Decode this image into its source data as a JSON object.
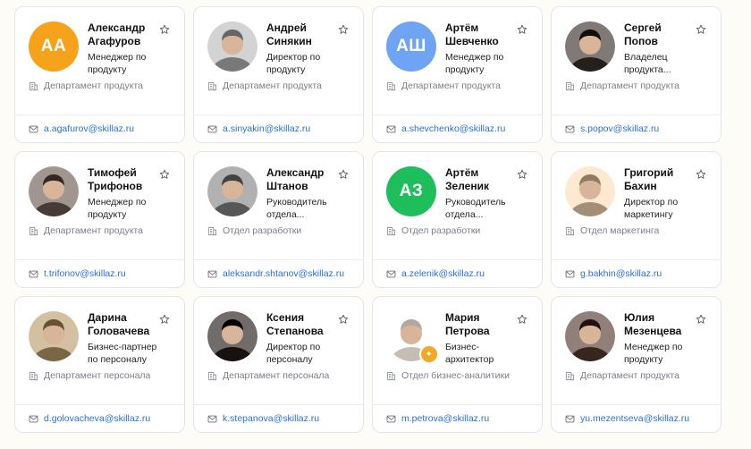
{
  "colors": {
    "accent_link": "#2a6fd6",
    "initials_orange": "#f7a21b",
    "initials_blue": "#6fa3f4",
    "initials_green": "#1fbe5d"
  },
  "employees": [
    {
      "name": "Александр Агафуров",
      "role": "Менеджер по продукту",
      "department": "Департамент продукта",
      "email": "a.agafurov@skillaz.ru",
      "avatar": {
        "type": "initials",
        "text": "АА",
        "color": "#f7a21b"
      }
    },
    {
      "name": "Андрей Синякин",
      "role": "Директор по продукту",
      "department": "Департамент продукта",
      "email": "a.sinyakin@skillaz.ru",
      "avatar": {
        "type": "photo",
        "tone": "#8d8d8d"
      }
    },
    {
      "name": "Артём Шевченко",
      "role": "Менеджер по продукту",
      "department": "Департамент продукта",
      "email": "a.shevchenko@skillaz.ru",
      "avatar": {
        "type": "initials",
        "text": "АШ",
        "color": "#6fa3f4"
      }
    },
    {
      "name": "Сергей Попов",
      "role": "Владелец продукта...",
      "department": "Департамент продукта",
      "email": "s.popov@skillaz.ru",
      "avatar": {
        "type": "photo",
        "tone": "#3a3330"
      }
    },
    {
      "name": "Тимофей Трифонов",
      "role": "Менеджер по продукту",
      "department": "Департамент продукта",
      "email": "t.trifonov@skillaz.ru",
      "avatar": {
        "type": "photo",
        "tone": "#5a4f49"
      }
    },
    {
      "name": "Александр Штанов",
      "role": "Руководитель отдела...",
      "department": "Отдел разработки",
      "email": "aleksandr.shtanov@skillaz.ru",
      "avatar": {
        "type": "photo",
        "tone": "#6b6b6b"
      }
    },
    {
      "name": "Артём Зеленик",
      "role": "Руководитель отдела...",
      "department": "Отдел разработки",
      "email": "a.zelenik@skillaz.ru",
      "avatar": {
        "type": "initials",
        "text": "АЗ",
        "color": "#1fbe5d"
      }
    },
    {
      "name": "Григорий Бахин",
      "role": "Директор по маркетингу",
      "department": "Отдел маркетинга",
      "email": "g.bakhin@skillaz.ru",
      "avatar": {
        "type": "photo",
        "tone": "#b9a28c"
      }
    },
    {
      "name": "Дарина Головачева",
      "role": "Бизнес-партнер по персоналу",
      "department": "Департамент персонала",
      "email": "d.golovacheva@skillaz.ru",
      "avatar": {
        "type": "photo",
        "tone": "#8c7a5a"
      }
    },
    {
      "name": "Ксения Степанова",
      "role": "Директор по персоналу",
      "department": "Департамент персонала",
      "email": "k.stepanova@skillaz.ru",
      "avatar": {
        "type": "photo",
        "tone": "#2b2523"
      }
    },
    {
      "name": "Мария Петрова",
      "role": "Бизнес-архитектор",
      "department": "Отдел бизнес-аналитики",
      "email": "m.petrova@skillaz.ru",
      "avatar": {
        "type": "photo",
        "tone": "#d9d1c8",
        "badge": true
      }
    },
    {
      "name": "Юлия Мезенцева",
      "role": "Менеджер по продукту",
      "department": "Департамент продукта",
      "email": "yu.mezentseva@skillaz.ru",
      "avatar": {
        "type": "photo",
        "tone": "#4b3a33"
      }
    }
  ]
}
